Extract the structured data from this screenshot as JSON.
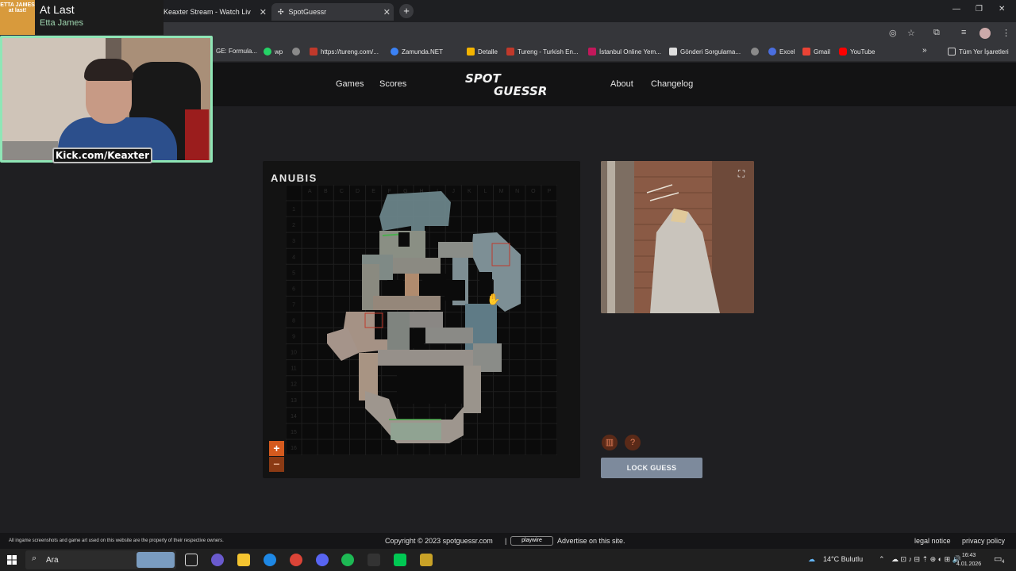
{
  "browser": {
    "tabs": [
      {
        "label": "Keaxter Stream - Watch Live on"
      },
      {
        "label": "SpotGuessr"
      }
    ],
    "bookmarks": [
      {
        "label": "GE: Formula...",
        "color": "#3a7bd5"
      },
      {
        "label": "wp",
        "color": "#25d366"
      },
      {
        "label": "",
        "color": "#8a8a8a"
      },
      {
        "label": "https://tureng.com/...",
        "color": "#c0392b"
      },
      {
        "label": "Zamunda.NET",
        "color": "#3b82f6"
      },
      {
        "label": "Detalle",
        "color": "#f4b400"
      },
      {
        "label": "Tureng - Turkish En...",
        "color": "#c0392b"
      },
      {
        "label": "İstanbul Online Yem...",
        "color": "#c2185b"
      },
      {
        "label": "Gönderi Sorgulama...",
        "color": "#dddddd"
      },
      {
        "label": "",
        "color": "#8a8a8a"
      },
      {
        "label": "Excel",
        "color": "#4a6ee0"
      },
      {
        "label": "Gmail",
        "color": "#ea4335"
      },
      {
        "label": "YouTube",
        "color": "#ff0000"
      }
    ],
    "bookmarks_overflow": "»",
    "all_bookmarks": "Tüm Yer İşaretleri"
  },
  "overlay": {
    "song_title": "At Last",
    "song_artist": "Etta James",
    "album_art_text": "ETTA JAMES at last!",
    "kick_label": "Kick.com/Keaxter"
  },
  "site": {
    "nav_left": [
      "Games",
      "Scores"
    ],
    "logo_line1": "SPOT",
    "logo_line2": "GUESSR",
    "nav_right": [
      "About",
      "Changelog"
    ],
    "accent": "#d45a1e"
  },
  "game": {
    "map_name": "ANUBIS",
    "grid_cols": [
      "A",
      "B",
      "C",
      "D",
      "E",
      "F",
      "G",
      "H",
      "I",
      "J",
      "K",
      "L",
      "M",
      "N",
      "O",
      "P"
    ],
    "grid_rows": [
      "1",
      "2",
      "3",
      "4",
      "5",
      "6",
      "7",
      "8",
      "9",
      "10",
      "11",
      "12",
      "13",
      "14",
      "15",
      "16"
    ],
    "zoom_in": "+",
    "zoom_out": "−",
    "map_toggle_icon": "map-icon",
    "help_icon": "?",
    "lock_button": "LOCK GUESS"
  },
  "footer": {
    "disclaimer": "All ingame screenshots and game art used on this website are the property of their respective owners.",
    "copyright": "Copyright © 2023 spotguessr.com",
    "separator": "|",
    "playwire": "playwire",
    "advertise": "Advertise on this site.",
    "legal": "legal notice",
    "privacy": "privacy policy"
  },
  "taskbar": {
    "search_placeholder": "Ara",
    "weather": "14°C  Bulutlu",
    "time": "16:43",
    "date": "4.01.2026",
    "notifications": "4"
  }
}
